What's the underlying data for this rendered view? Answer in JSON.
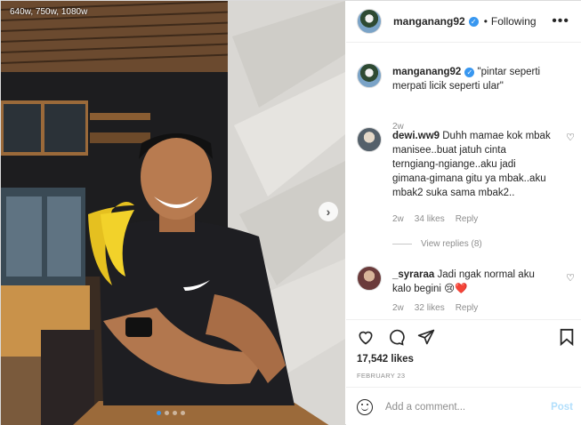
{
  "media": {
    "size_hint": "640w, 750w, 1080w",
    "next_icon": "chevron-right-icon",
    "carousel_dots": [
      true,
      false,
      false,
      false
    ]
  },
  "header": {
    "username": "manganang92",
    "separator": "•",
    "follow_status": "Following",
    "more_icon": "ellipsis-icon"
  },
  "caption": {
    "username": "manganang92",
    "text": "\"pintar seperti merpati licik seperti ular\"",
    "age": "2w"
  },
  "comments": [
    {
      "username": "dewi.ww9",
      "text": "Duhh mamae kok mbak manisee..buat jatuh cinta terngiang-ngiange..aku jadi gimana-gimana gitu ya mbak..aku mbak2 suka sama mbak2..",
      "age": "2w",
      "likes": "34 likes",
      "reply": "Reply",
      "view_replies": "View replies (8)"
    },
    {
      "username": "_syraraa",
      "text": "Jadi ngak normal aku kalo begini 😢❤️",
      "age": "2w",
      "likes": "32 likes",
      "reply": "Reply"
    }
  ],
  "actions": {
    "likes": "17,542 likes",
    "date": "FEBRUARY 23"
  },
  "add_comment": {
    "placeholder": "Add a comment...",
    "post": "Post"
  },
  "colors": {
    "accent": "#3897f0",
    "post_disabled": "#b2dffc",
    "muted": "#8e8e8e"
  }
}
